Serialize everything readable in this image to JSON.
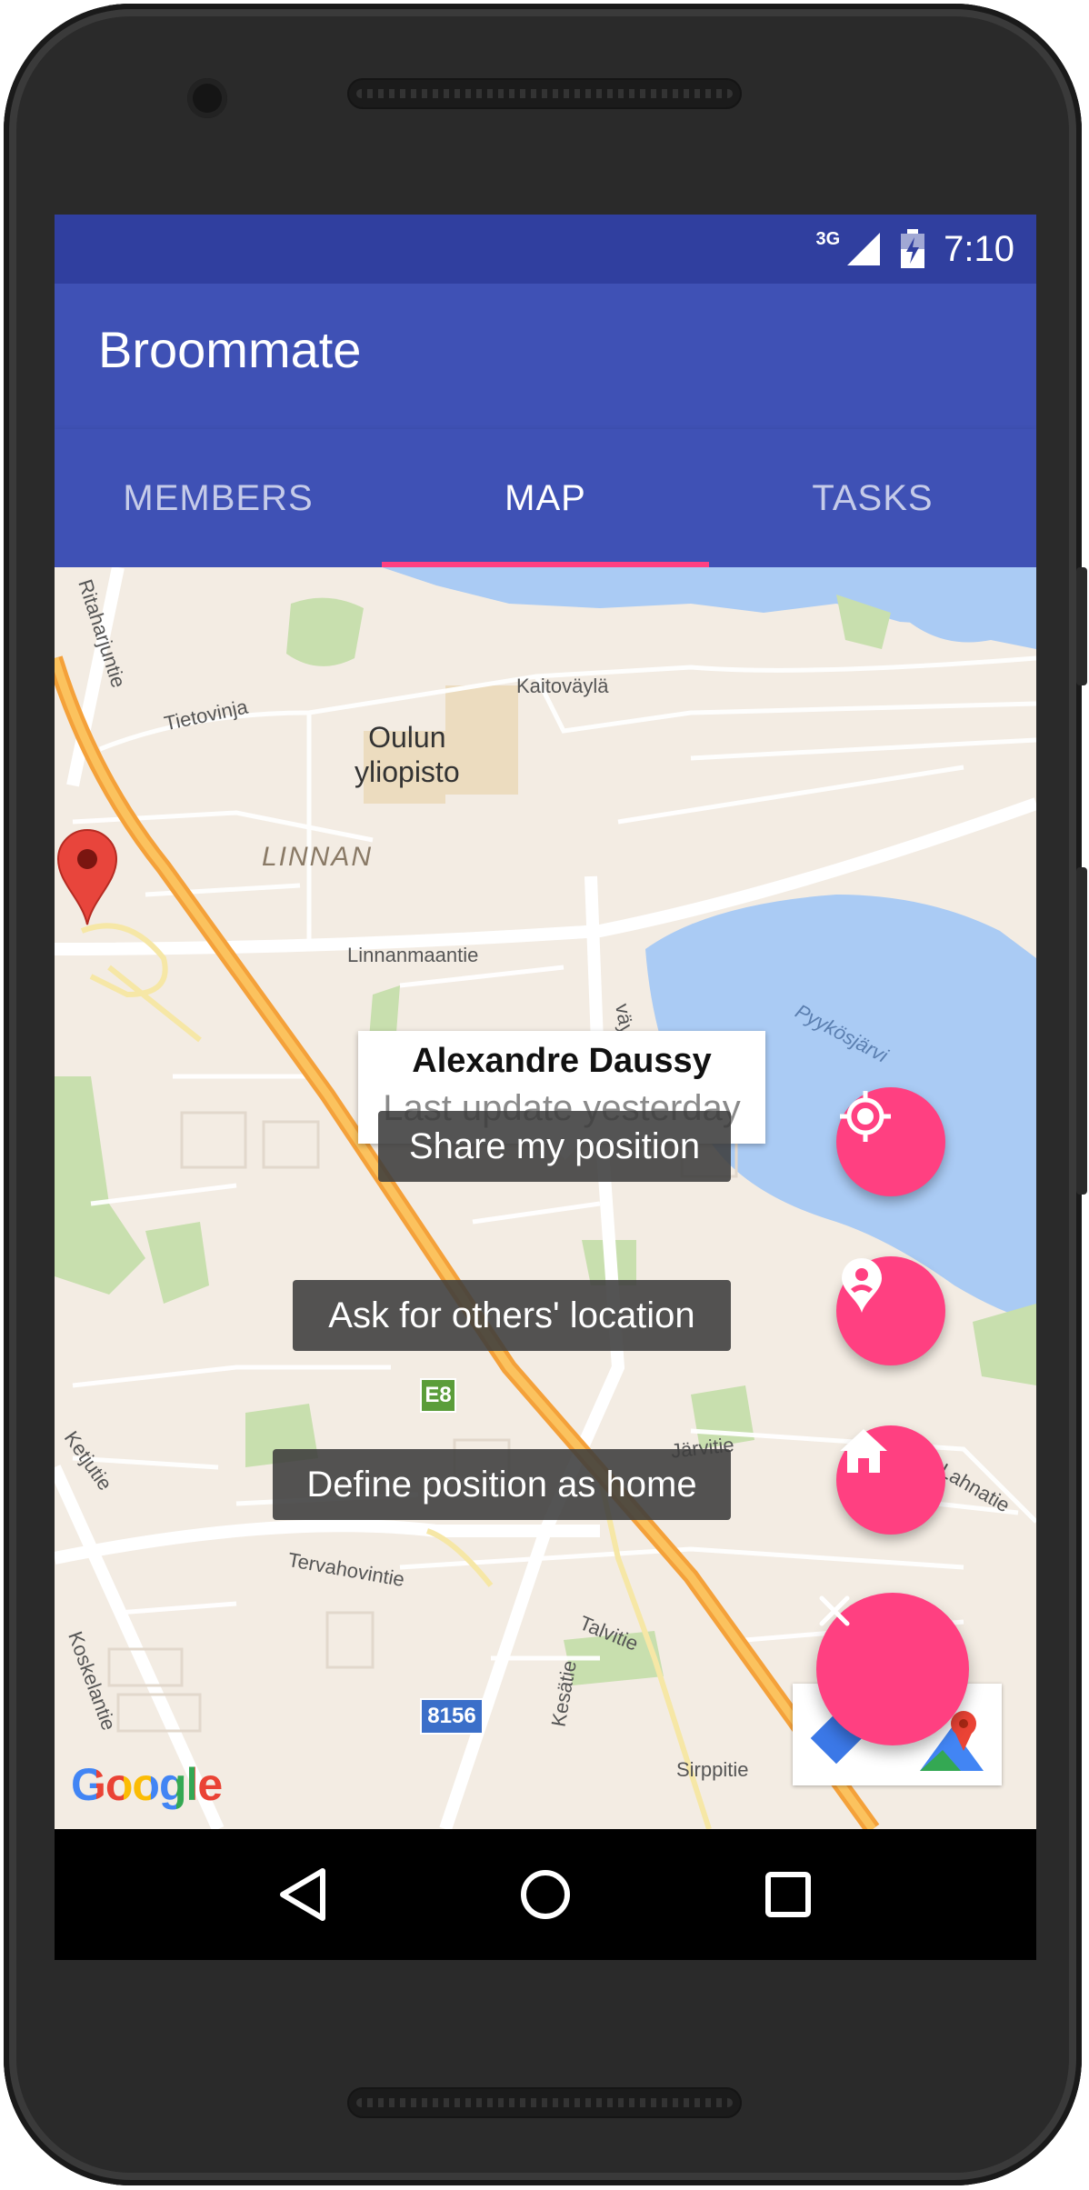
{
  "status_bar": {
    "network": "3G",
    "time": "7:10",
    "icons": [
      "signal-icon",
      "battery-icon"
    ]
  },
  "app": {
    "title": "Broommate"
  },
  "tabs": [
    {
      "label": "MEMBERS",
      "active": false
    },
    {
      "label": "MAP",
      "active": true
    },
    {
      "label": "TASKS",
      "active": false
    }
  ],
  "map": {
    "place_labels": {
      "university": "Oulun\nyliopisto",
      "district": "LINNAN",
      "road_kaitovayla": "Kaitoväylä",
      "road_linnanmaantie": "Linnanmaantie",
      "road_tietovinja": "Tietovinja",
      "road_ritaharjuntie": "Ritaharjuntie",
      "lake": "Pyykösjärvi",
      "road_jarvitie": "Järvitie",
      "road_lahnatie": "Lahnatie",
      "road_ketjutie": "Ketjutie",
      "road_tervahovintie": "Tervahovintie",
      "road_koskelantie": "Koskelantie",
      "road_talvitie": "Talvitie",
      "road_kesatie": "Kesätie",
      "road_sirppitie": "Sirppitie",
      "road_vaylantie": "väyläntie",
      "shield_e8": "E8",
      "shield_8156": "8156"
    },
    "attribution": "Google",
    "marker": {
      "name": "Alexandre Daussy",
      "subtitle": "Last update yesterday"
    }
  },
  "fab_menu": {
    "actions": [
      {
        "label": "Share my position",
        "icon": "my-location-icon"
      },
      {
        "label": "Ask for others' location",
        "icon": "person-pin-icon"
      },
      {
        "label": "Define position as home",
        "icon": "home-icon"
      }
    ],
    "main_icon": "close-icon"
  },
  "colors": {
    "primary": "#3f51b5",
    "primary_dark": "#303f9f",
    "accent": "#ff4081"
  },
  "nav_bar": {
    "icons": [
      "back-icon",
      "home-circle-icon",
      "recents-icon"
    ]
  }
}
